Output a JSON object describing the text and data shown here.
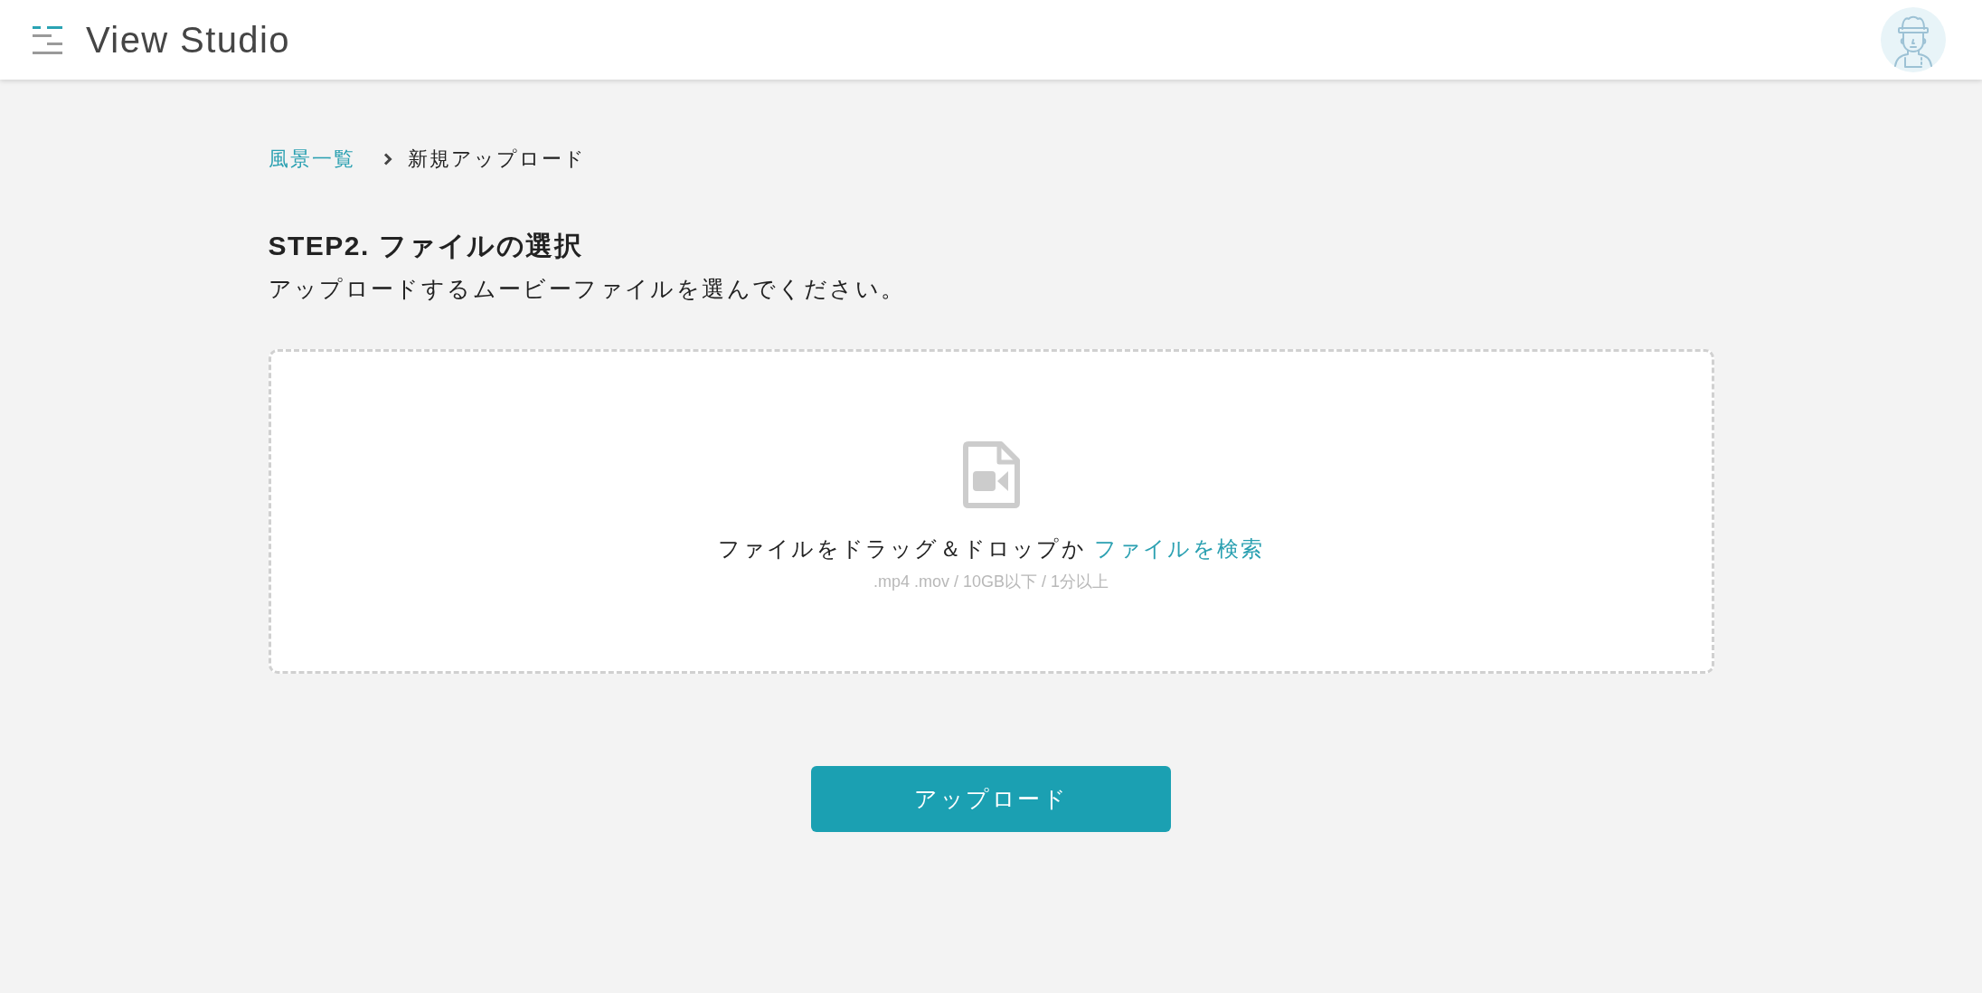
{
  "header": {
    "title": "View Studio"
  },
  "breadcrumb": [
    {
      "label": "風景一覧",
      "kind": "link"
    },
    {
      "label": "新規アップロード",
      "kind": "current"
    }
  ],
  "step": {
    "title": "STEP2. ファイルの選択",
    "description": "アップロードするムービーファイルを選んでください。"
  },
  "drop_zone": {
    "instruction": "ファイルをドラッグ＆ドロップか",
    "link": "ファイルを検索",
    "requirements": ".mp4 .mov / 10GB以下 / 1分以上"
  },
  "upload_button": {
    "label": "アップロード"
  }
}
